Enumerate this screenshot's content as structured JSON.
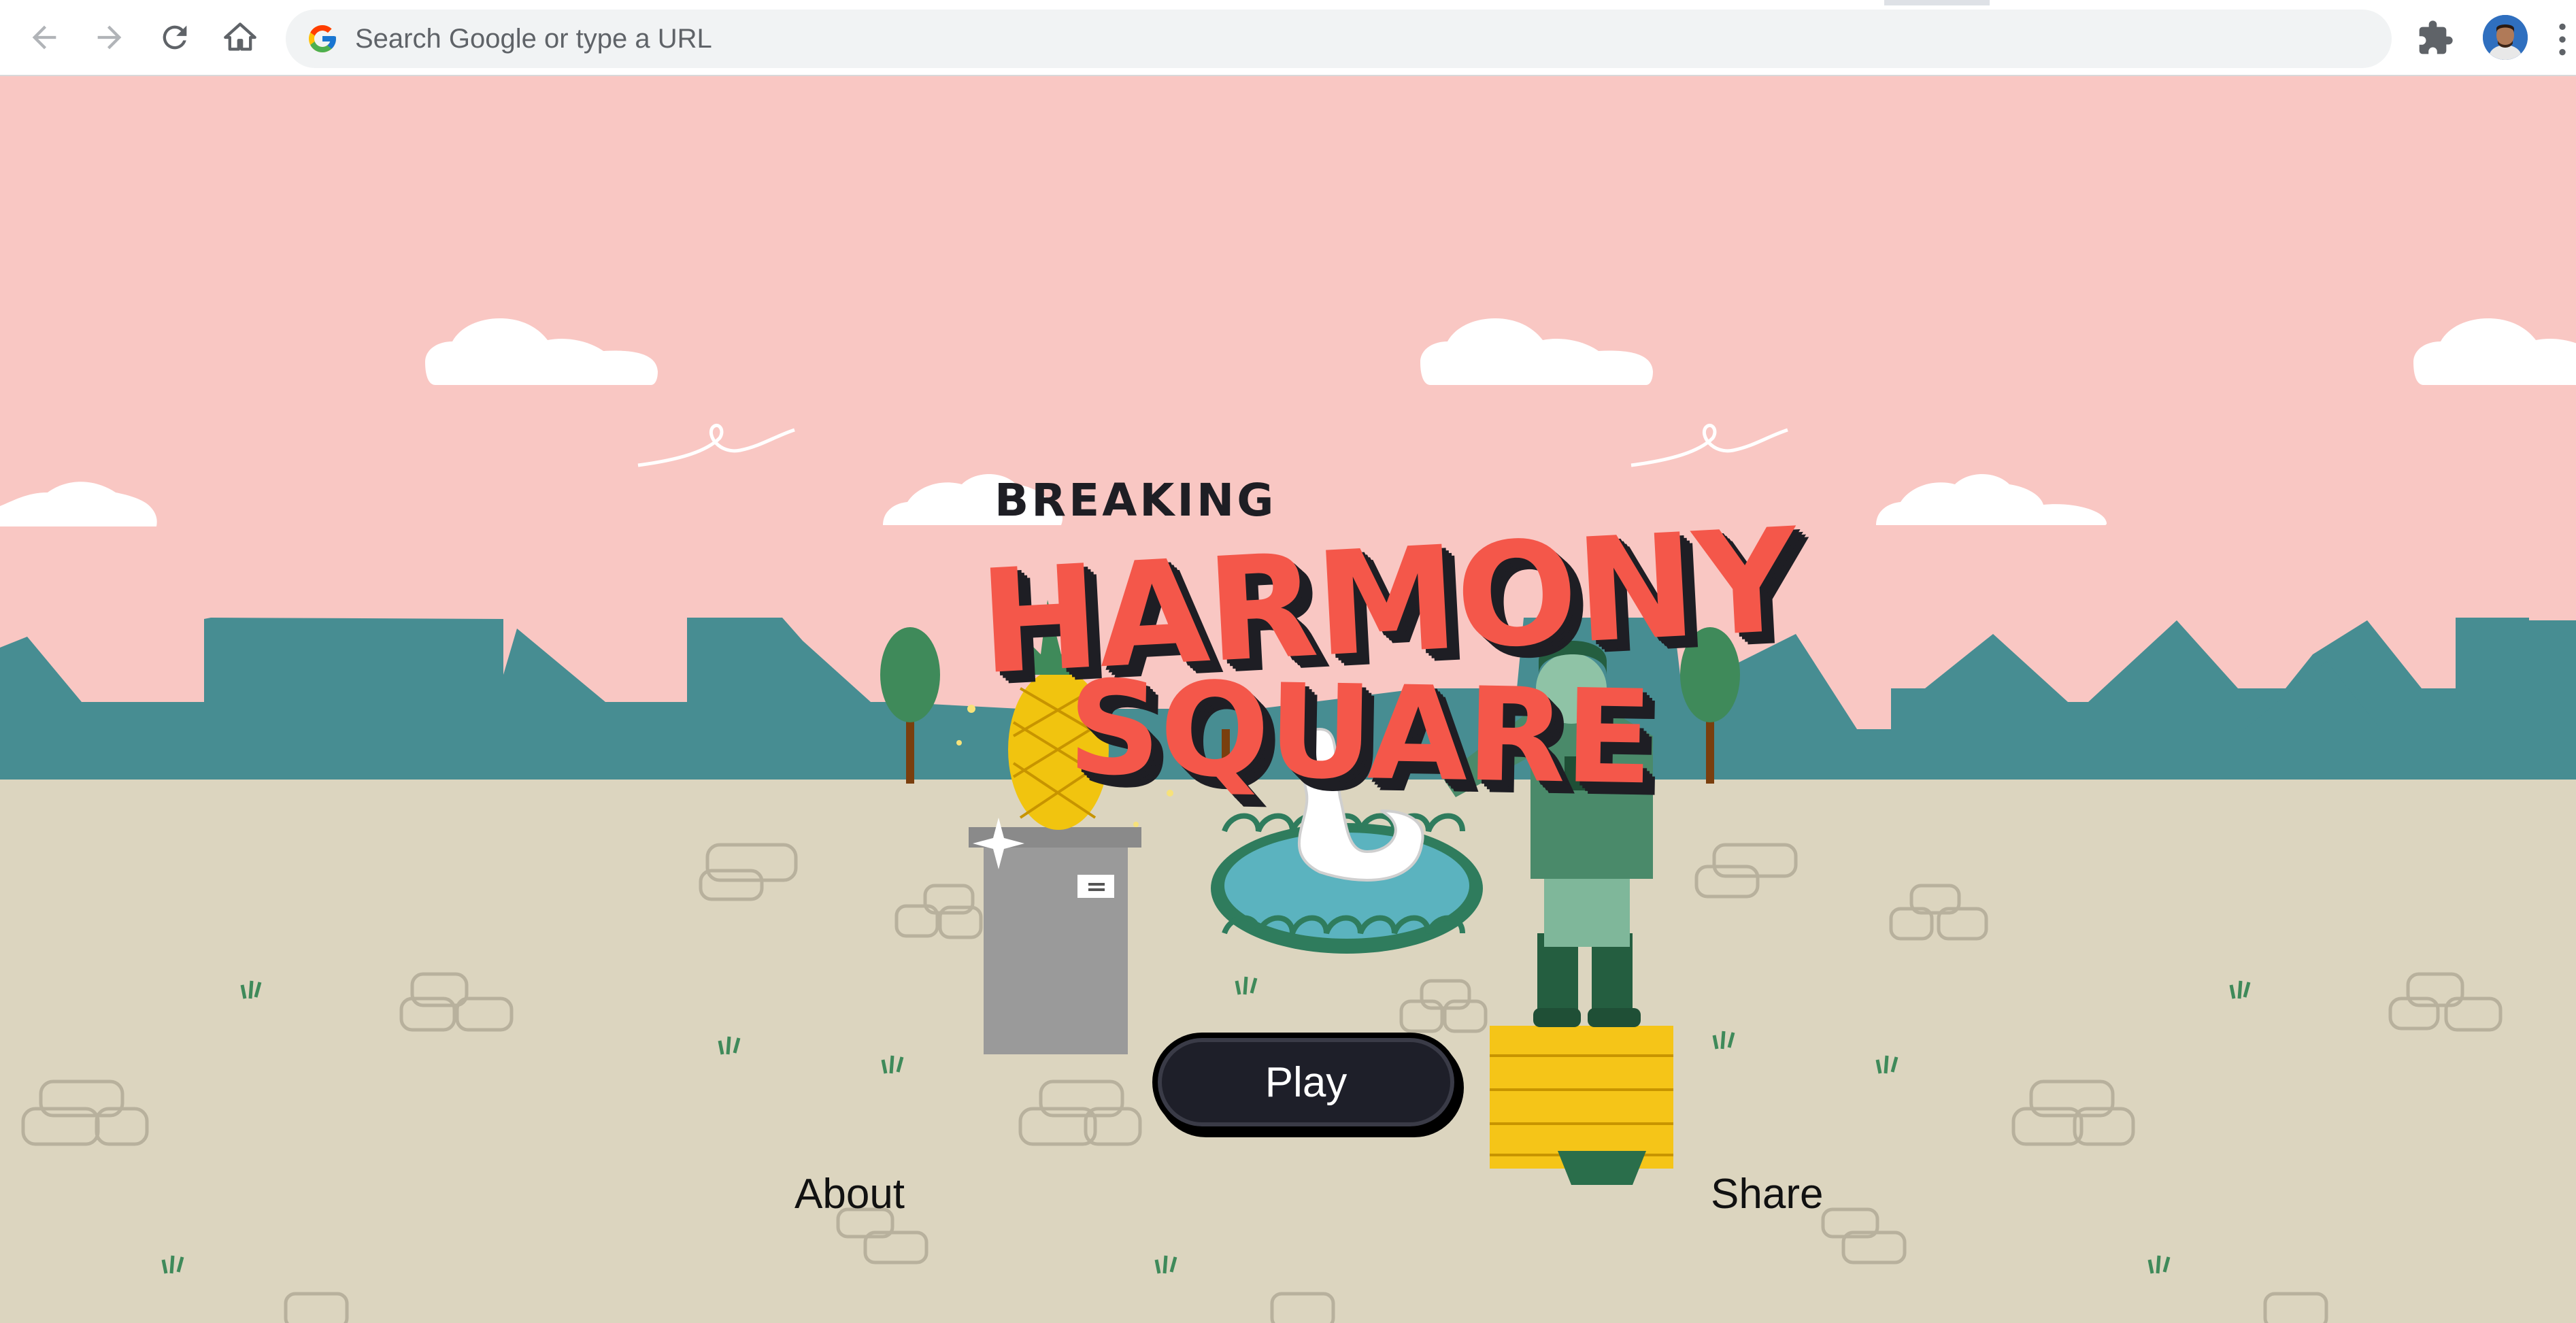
{
  "browser": {
    "back_label": "Back",
    "forward_label": "Forward",
    "reload_label": "Reload",
    "home_label": "Home",
    "omnibox_placeholder": "Search Google or type a URL",
    "extensions_label": "Extensions",
    "profile_label": "Profile",
    "menu_label": "Menu"
  },
  "game": {
    "title_top": "BREAKING",
    "title_line1": "HARMONY",
    "title_line2": "SQUARE",
    "play_label": "Play",
    "about_label": "About",
    "share_label": "Share"
  },
  "colors": {
    "sky": "#f9c7c3",
    "hills": "#478d92",
    "ground": "#dcd5bf",
    "title_red": "#f4574a",
    "button_dark": "#1e1f29"
  }
}
